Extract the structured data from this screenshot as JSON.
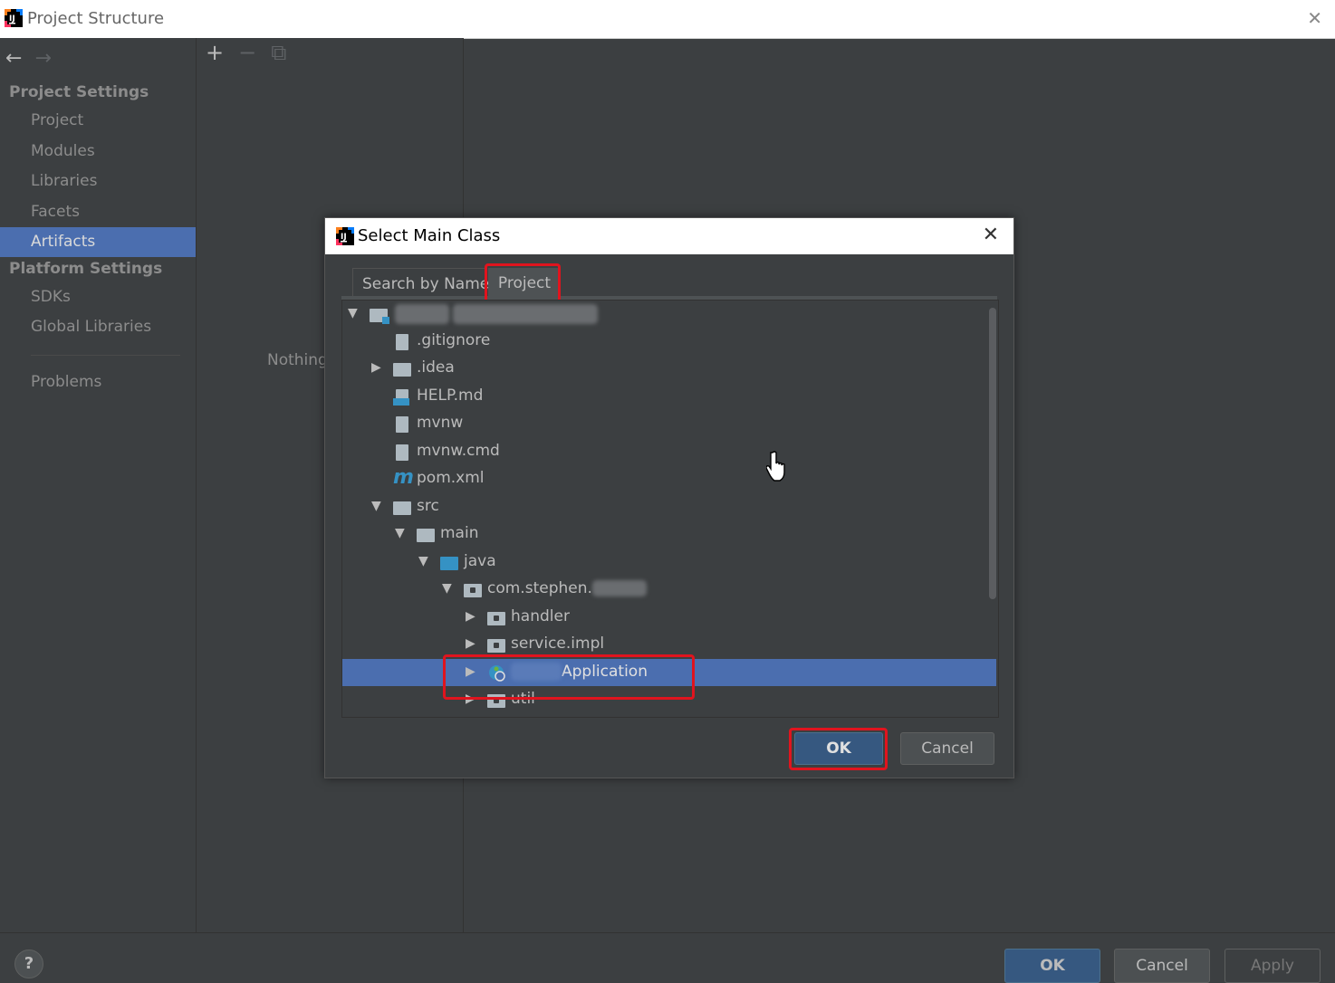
{
  "window": {
    "title": "Project Structure",
    "close_glyph": "✕"
  },
  "sidebar": {
    "back_glyph": "←",
    "forward_glyph": "→",
    "project_settings_header": "Project Settings",
    "project_settings_items": [
      "Project",
      "Modules",
      "Libraries",
      "Facets",
      "Artifacts"
    ],
    "selected_item": "Artifacts",
    "platform_settings_header": "Platform Settings",
    "platform_settings_items": [
      "SDKs",
      "Global Libraries"
    ],
    "problems_item": "Problems"
  },
  "middle": {
    "add_glyph": "+",
    "remove_glyph": "−",
    "copy_glyph": "⧉",
    "nothing_text": "Nothing"
  },
  "footer": {
    "help_label": "?",
    "ok_label": "OK",
    "cancel_label": "Cancel",
    "apply_label": "Apply"
  },
  "dialog": {
    "title": "Select Main Class",
    "close_glyph": "✕",
    "tabs": [
      "Search by Name",
      "Project"
    ],
    "active_tab": "Project",
    "ok_label": "OK",
    "cancel_label": "Cancel",
    "tree": [
      {
        "label": "",
        "icon": "module-folder-icon",
        "arrow": "▼",
        "blurred": true
      },
      {
        "label": ".gitignore",
        "icon": "text-file-icon",
        "arrow": ""
      },
      {
        "label": ".idea",
        "icon": "folder-icon",
        "arrow": "▶"
      },
      {
        "label": "HELP.md",
        "icon": "markdown-file-icon",
        "arrow": ""
      },
      {
        "label": "mvnw",
        "icon": "text-file-icon",
        "arrow": ""
      },
      {
        "label": "mvnw.cmd",
        "icon": "text-file-icon",
        "arrow": ""
      },
      {
        "label": "pom.xml",
        "icon": "maven-icon",
        "arrow": ""
      },
      {
        "label": "src",
        "icon": "folder-icon",
        "arrow": "▼"
      },
      {
        "label": "main",
        "icon": "folder-icon",
        "arrow": "▼"
      },
      {
        "label": "java",
        "icon": "source-folder-icon",
        "arrow": "▼"
      },
      {
        "label": "com.stephen.",
        "icon": "package-icon",
        "arrow": "▼"
      },
      {
        "label": "handler",
        "icon": "package-icon",
        "arrow": "▶"
      },
      {
        "label": "service.impl",
        "icon": "package-icon",
        "arrow": "▶"
      },
      {
        "label": "Application",
        "icon": "spring-boot-class-icon",
        "arrow": "▶",
        "selected": true
      },
      {
        "label": "util",
        "icon": "package-icon",
        "arrow": "▶"
      }
    ]
  },
  "colors": {
    "background": "#3c3f41",
    "selection": "#4b6eaf",
    "highlight_box": "#e0141e",
    "ok_button": "#365880"
  }
}
